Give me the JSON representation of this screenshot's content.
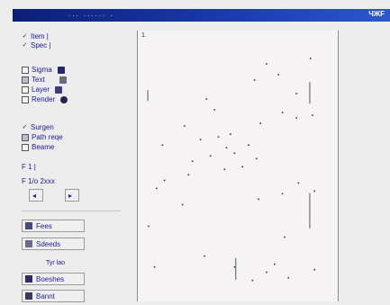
{
  "window": {
    "title": "...   ......   .",
    "title_right": "ЧЖF"
  },
  "panel": {
    "options": [
      {
        "label": "Item |",
        "checked": true
      },
      {
        "label": "Spec |",
        "checked": true
      }
    ],
    "series": [
      {
        "label": "Sigma",
        "checked": false,
        "color": "#26266e"
      },
      {
        "label": "Text",
        "checked": true,
        "color": "#6a6a80"
      },
      {
        "label": "Layer",
        "checked": false,
        "color": "#3b3b7a"
      },
      {
        "label": "Render",
        "checked": false,
        "color": "#24244f"
      }
    ],
    "display": [
      {
        "label": "Surgen",
        "checked": true
      },
      {
        "label": "Path reqe",
        "checked": true
      },
      {
        "label": "Beame",
        "checked": false
      }
    ],
    "range": {
      "label1": "F 1 |",
      "label2": "F 1/o   2xxx"
    },
    "buttons": {
      "b1": "Fees",
      "b2": "Sdeeds",
      "group_label": "Tyr lao",
      "b3": "Boeshes",
      "b4": "Bannt"
    }
  },
  "plot": {
    "corner_label": "1.",
    "points": [
      [
        0.64,
        0.12
      ],
      [
        0.7,
        0.16
      ],
      [
        0.58,
        0.18
      ],
      [
        0.86,
        0.1
      ],
      [
        0.79,
        0.23
      ],
      [
        0.34,
        0.25
      ],
      [
        0.38,
        0.29
      ],
      [
        0.23,
        0.35
      ],
      [
        0.72,
        0.3
      ],
      [
        0.87,
        0.31
      ],
      [
        0.79,
        0.32
      ],
      [
        0.61,
        0.34
      ],
      [
        0.46,
        0.38
      ],
      [
        0.4,
        0.39
      ],
      [
        0.31,
        0.4
      ],
      [
        0.12,
        0.42
      ],
      [
        0.55,
        0.42
      ],
      [
        0.44,
        0.43
      ],
      [
        0.48,
        0.45
      ],
      [
        0.36,
        0.46
      ],
      [
        0.59,
        0.47
      ],
      [
        0.27,
        0.48
      ],
      [
        0.52,
        0.5
      ],
      [
        0.43,
        0.51
      ],
      [
        0.25,
        0.53
      ],
      [
        0.13,
        0.55
      ],
      [
        0.09,
        0.58
      ],
      [
        0.8,
        0.56
      ],
      [
        0.88,
        0.59
      ],
      [
        0.72,
        0.6
      ],
      [
        0.6,
        0.62
      ],
      [
        0.22,
        0.64
      ],
      [
        0.05,
        0.72
      ],
      [
        0.73,
        0.76
      ],
      [
        0.33,
        0.83
      ],
      [
        0.08,
        0.87
      ],
      [
        0.48,
        0.87
      ],
      [
        0.68,
        0.86
      ],
      [
        0.64,
        0.89
      ],
      [
        0.88,
        0.88
      ],
      [
        0.75,
        0.91
      ],
      [
        0.57,
        0.92
      ]
    ],
    "lines": [
      [
        0.86,
        0.19,
        0.86,
        0.27
      ],
      [
        0.86,
        0.6,
        0.86,
        0.73
      ],
      [
        0.49,
        0.84,
        0.49,
        0.92
      ],
      [
        0.05,
        0.22,
        0.05,
        0.26
      ]
    ]
  }
}
